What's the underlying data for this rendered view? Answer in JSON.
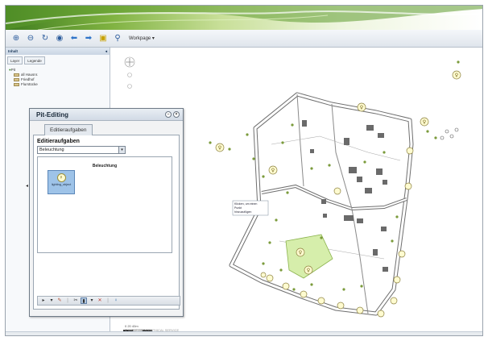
{
  "toolbar": {
    "buttons": [
      "zoom-in-icon",
      "zoom-out-icon",
      "refresh-icon",
      "globe-icon",
      "back-arrow-icon",
      "forward-arrow-icon",
      "identify-icon",
      "measure-icon"
    ],
    "workspace_label": "Workpage ▾"
  },
  "left_panel": {
    "title": "Inhalt",
    "tabs": [
      "Layer",
      "Legende"
    ],
    "tree": {
      "root": "Pit",
      "items": [
        "all Hausnr.",
        "Friedhof",
        "Flurstücke"
      ]
    }
  },
  "editing": {
    "title": "Pit-Editing",
    "tab": "Editieraufgaben",
    "caption": "Editieraufgaben",
    "selected": "Beleuchtung",
    "panel_title": "Beleuchtung",
    "object_label": "lighting_object"
  },
  "map": {
    "tooltip_lines": [
      "Klicken, um einen",
      "Punkt",
      "hinzuzufügen"
    ],
    "scale_text": "0    20    40m",
    "scale_sub": "© WOLF GEOGRAPHICAL SERVICE"
  },
  "colors": {
    "accent": "#3f7d1f",
    "highlight_area": "#d6eeab",
    "lamp_fill": "#fffbd0",
    "selection": "#9ec3e8"
  }
}
